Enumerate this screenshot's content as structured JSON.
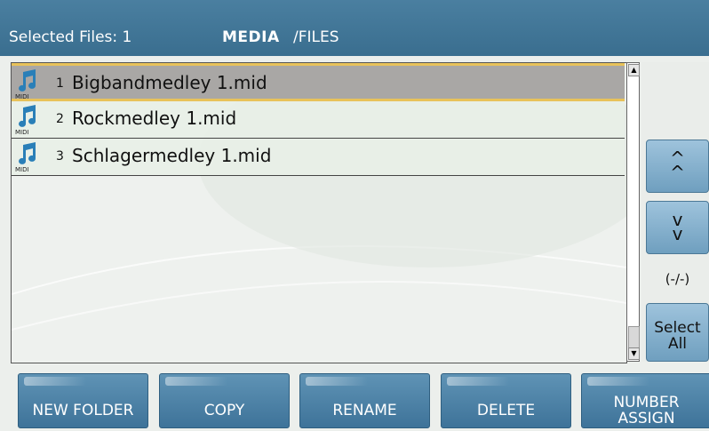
{
  "header": {
    "selected_label": "Selected Files: 1",
    "location": "MEDIA",
    "path": "/FILES"
  },
  "files": [
    {
      "index": "1",
      "name": "Bigbandmedley 1.mid",
      "type_label": "MIDI",
      "icon": "music-note-icon",
      "selected": true
    },
    {
      "index": "2",
      "name": "Rockmedley 1.mid",
      "type_label": "MIDI",
      "icon": "music-note-icon",
      "selected": false
    },
    {
      "index": "3",
      "name": "Schlagermedley 1.mid",
      "type_label": "MIDI",
      "icon": "music-note-icon",
      "selected": false
    }
  ],
  "side": {
    "page_up_glyph": "^\n^",
    "page_down_glyph": "v\nv",
    "page_indicator": "(-/-)",
    "select_all_line1": "Select",
    "select_all_line2": "All"
  },
  "toolbar": {
    "new_folder": "NEW FOLDER",
    "copy": "COPY",
    "rename": "RENAME",
    "delete": "DELETE",
    "number_assign_line1": "NUMBER",
    "number_assign_line2": "ASSIGN"
  },
  "colors": {
    "header": "#3a6e8f",
    "button": "#4a7fa3",
    "selection": "#a9a7a5",
    "selection_border": "#e8c25a",
    "icon": "#2a7fb8"
  }
}
